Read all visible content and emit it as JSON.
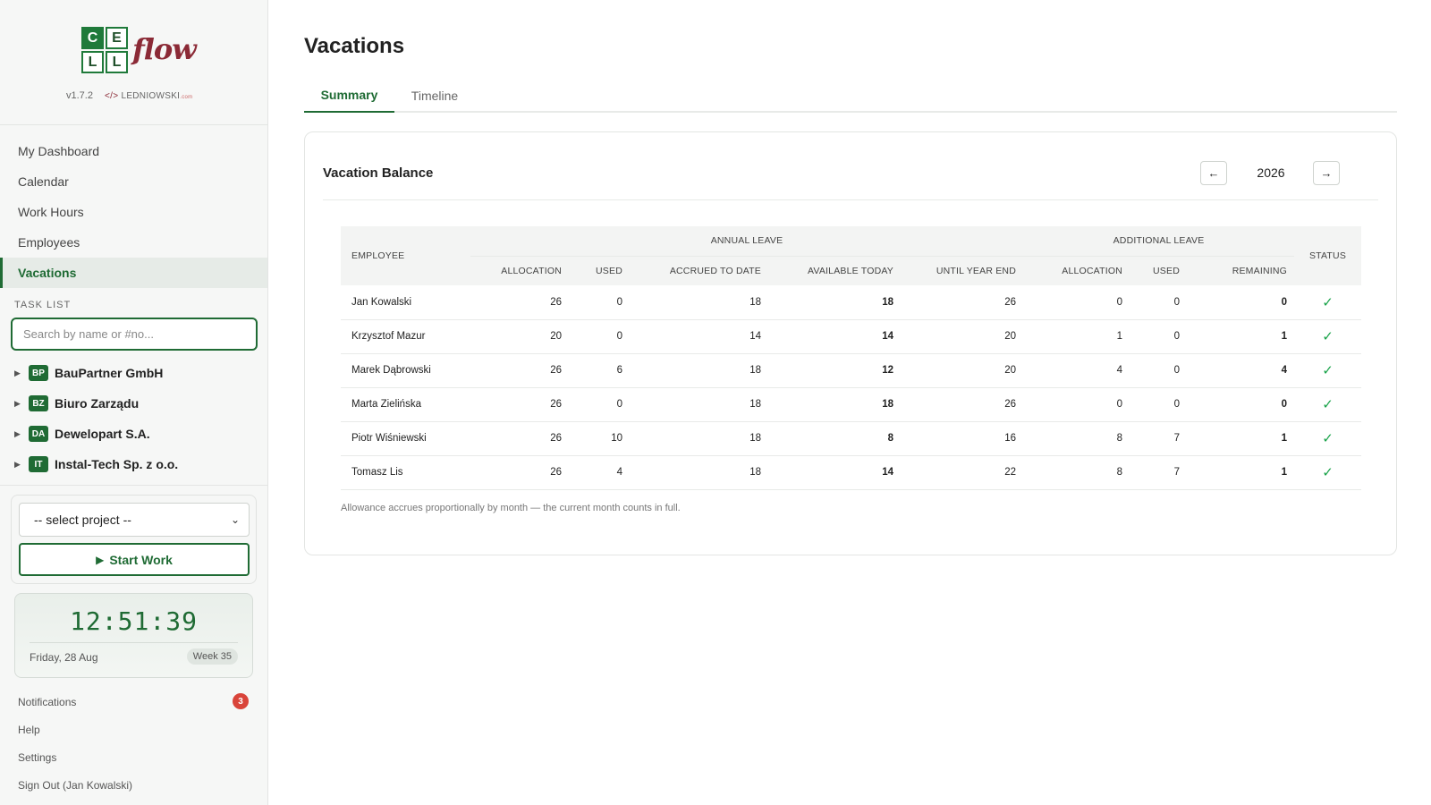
{
  "app": {
    "logo_letters": [
      "C",
      "E",
      "L",
      "L"
    ],
    "logo_word": "flow",
    "version": "v1.7.2",
    "author_code": "</>",
    "author": "LEDNIOWSKI",
    "author_suffix": ".com"
  },
  "sidebar": {
    "nav": [
      {
        "label": "My Dashboard",
        "active": false
      },
      {
        "label": "Calendar",
        "active": false
      },
      {
        "label": "Work Hours",
        "active": false
      },
      {
        "label": "Employees",
        "active": false
      },
      {
        "label": "Vacations",
        "active": true
      }
    ],
    "task_list_label": "TASK LIST",
    "search_placeholder": "Search by name or #no...",
    "clients": [
      {
        "badge": "BP",
        "name": "BauPartner GmbH"
      },
      {
        "badge": "BZ",
        "name": "Biuro Zarządu"
      },
      {
        "badge": "DA",
        "name": "Dewelopart S.A."
      },
      {
        "badge": "IT",
        "name": "Instal-Tech Sp. z o.o."
      }
    ],
    "project_select": "-- select project --",
    "start_work": "Start Work",
    "clock": {
      "time": "12:51:39",
      "date": "Friday, 28 Aug",
      "week": "Week 35"
    },
    "footer": {
      "notifications": "Notifications",
      "notifications_count": "3",
      "help": "Help",
      "settings": "Settings",
      "sign_out": "Sign Out (Jan Kowalski)"
    }
  },
  "main": {
    "title": "Vacations",
    "tabs": [
      {
        "label": "Summary",
        "active": true
      },
      {
        "label": "Timeline",
        "active": false
      }
    ],
    "card": {
      "title": "Vacation Balance",
      "prev": "←",
      "next": "→",
      "year": "2026",
      "headers": {
        "employee": "EMPLOYEE",
        "annual_leave": "ANNUAL LEAVE",
        "additional_leave": "ADDITIONAL LEAVE",
        "status": "STATUS",
        "allocation": "ALLOCATION",
        "used": "USED",
        "accrued": "ACCRUED TO DATE",
        "available": "AVAILABLE TODAY",
        "until_year_end": "UNTIL YEAR END",
        "add_allocation": "ALLOCATION",
        "add_used": "USED",
        "remaining": "REMAINING"
      },
      "rows": [
        {
          "name": "Jan Kowalski",
          "allocation": "26",
          "used": "0",
          "accrued": "18",
          "available": "18",
          "until": "26",
          "add_alloc": "0",
          "add_used": "0",
          "remaining": "0",
          "status": "✓"
        },
        {
          "name": "Krzysztof Mazur",
          "allocation": "20",
          "used": "0",
          "accrued": "14",
          "available": "14",
          "until": "20",
          "add_alloc": "1",
          "add_used": "0",
          "remaining": "1",
          "status": "✓"
        },
        {
          "name": "Marek Dąbrowski",
          "allocation": "26",
          "used": "6",
          "accrued": "18",
          "available": "12",
          "until": "20",
          "add_alloc": "4",
          "add_used": "0",
          "remaining": "4",
          "status": "✓"
        },
        {
          "name": "Marta Zielińska",
          "allocation": "26",
          "used": "0",
          "accrued": "18",
          "available": "18",
          "until": "26",
          "add_alloc": "0",
          "add_used": "0",
          "remaining": "0",
          "status": "✓"
        },
        {
          "name": "Piotr Wiśniewski",
          "allocation": "26",
          "used": "10",
          "accrued": "18",
          "available": "8",
          "until": "16",
          "add_alloc": "8",
          "add_used": "7",
          "remaining": "1",
          "status": "✓"
        },
        {
          "name": "Tomasz Lis",
          "allocation": "26",
          "used": "4",
          "accrued": "18",
          "available": "14",
          "until": "22",
          "add_alloc": "8",
          "add_used": "7",
          "remaining": "1",
          "status": "✓"
        }
      ],
      "note": "Allowance accrues proportionally by month — the current month counts in full."
    }
  },
  "colors": {
    "brand_green": "#1f6b34",
    "brand_red": "#8b2a36",
    "check_green": "#1aa34a",
    "badge_red": "#d9443a"
  }
}
